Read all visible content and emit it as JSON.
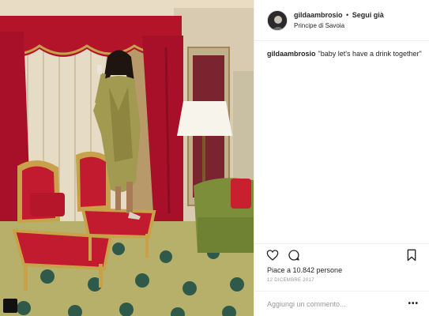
{
  "post": {
    "username": "gildaambrosio",
    "follow_label": "Segui già",
    "separator": "•",
    "location": "Principe di Savoia",
    "caption_user": "gildaambrosio",
    "caption_text": "\"baby let's have a drink together\"",
    "likes_text": "Piace a 10.842 persone",
    "date": "12 DICEMBRE 2017",
    "comment_placeholder": "Aggiungi un commento...",
    "more_label": "•••"
  },
  "icons": {
    "like": "heart-icon",
    "comment": "comment-icon",
    "save": "bookmark-icon",
    "more": "more-options-icon"
  },
  "colors": {
    "text": "#262626",
    "muted": "#999999",
    "divider": "#efefef",
    "curtain_red": "#b3142a",
    "gold": "#c8a24a"
  }
}
